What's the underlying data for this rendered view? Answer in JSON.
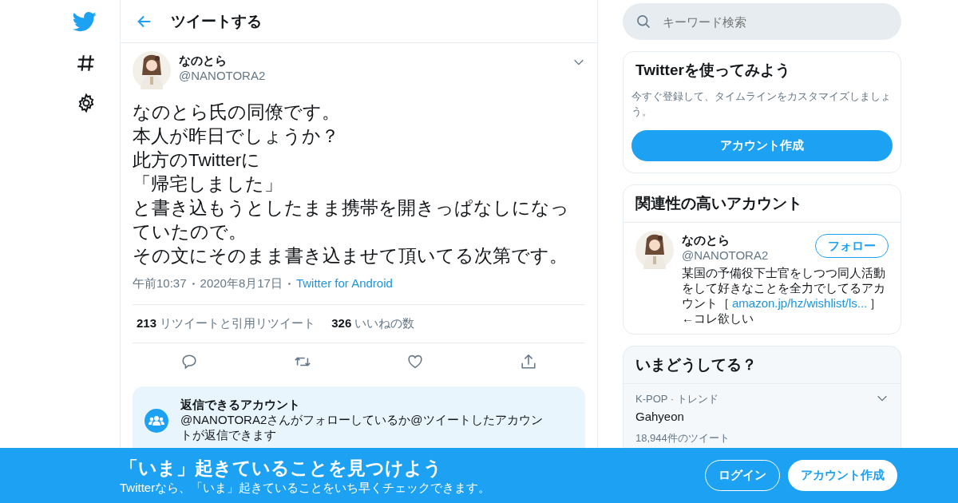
{
  "header": {
    "title": "ツイートする"
  },
  "tweet": {
    "name": "なのとら",
    "handle": "@NANOTORA2",
    "lines": [
      "なのとら氏の同僚です。",
      "本人が昨日でしょうか？",
      "此方のTwitterに",
      "「帰宅しました」",
      "と書き込もうとしたまま携帯を開きっぱなしになっていたので。",
      "その文にそのまま書き込ませて頂いてる次第です。"
    ],
    "time": "午前10:37",
    "date": "2020年8月17日",
    "source": "Twitter for Android",
    "stats": [
      {
        "count": "213",
        "label": "リツイートと引用リツイート"
      },
      {
        "count": "326",
        "label": "いいねの数"
      }
    ]
  },
  "reply_info": {
    "title": "返信できるアカウント",
    "text": "@NANOTORA2さんがフォローしているか@ツイートしたアカウントが返信できます"
  },
  "search": {
    "placeholder": "キーワード検索"
  },
  "signup_card": {
    "title": "Twitterを使ってみよう",
    "text": "今すぐ登録して、タイムラインをカスタマイズしましょう。",
    "button": "アカウント作成"
  },
  "related": {
    "title": "関連性の高いアカウント",
    "name": "なのとら",
    "handle": "@NANOTORA2",
    "follow": "フォロー",
    "bio": "某国の予備役下士官をしつつ同人活動をして好きなことを全力でしてるアカウント［",
    "link": "amazon.jp/hz/wishlist/ls...",
    "bio_end": "］←コレ欲しい"
  },
  "trends": {
    "title": "いまどうしてる？",
    "items": [
      {
        "context": "K-POP · トレンド",
        "name": "Gahyeon",
        "count": "18,944件のツイート"
      }
    ]
  },
  "banner": {
    "title": "「いま」起きていることを見つけよう",
    "text": "Twitterなら、「いま」起きていることをいち早くチェックできます。",
    "login": "ログイン",
    "signup": "アカウント作成"
  }
}
